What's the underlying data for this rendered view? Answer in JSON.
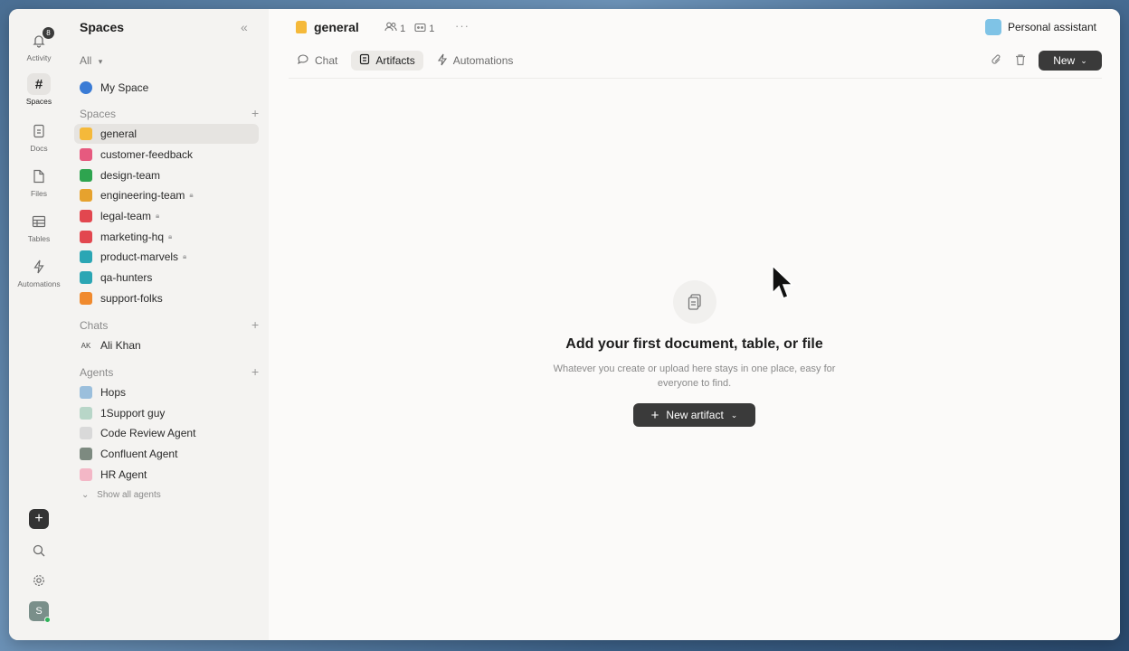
{
  "rail": {
    "activity_label": "Activity",
    "activity_badge": "8",
    "spaces_label": "Spaces",
    "docs_label": "Docs",
    "files_label": "Files",
    "tables_label": "Tables",
    "automations_label": "Automations",
    "user_initial": "S"
  },
  "sidebar": {
    "title": "Spaces",
    "filter": "All",
    "my_space": "My Space",
    "spaces_header": "Spaces",
    "spaces": [
      {
        "label": "general",
        "color": "#f5b93a"
      },
      {
        "label": "customer-feedback",
        "color": "#e65a7f"
      },
      {
        "label": "design-team",
        "color": "#2ea44f"
      },
      {
        "label": "engineering-team",
        "color": "#e6a22e"
      },
      {
        "label": "legal-team",
        "color": "#e2474f"
      },
      {
        "label": "marketing-hq",
        "color": "#e2474f"
      },
      {
        "label": "product-marvels",
        "color": "#2ba6b4"
      },
      {
        "label": "qa-hunters",
        "color": "#2ba6b4"
      },
      {
        "label": "support-folks",
        "color": "#f08a2e"
      }
    ],
    "chats_header": "Chats",
    "chats": [
      {
        "initials": "AK",
        "label": "Ali Khan"
      }
    ],
    "agents_header": "Agents",
    "agents": [
      {
        "label": "Hops"
      },
      {
        "label": "1Support guy"
      },
      {
        "label": "Code Review Agent"
      },
      {
        "label": "Confluent Agent"
      },
      {
        "label": "HR Agent"
      }
    ],
    "show_all": "Show all agents"
  },
  "header": {
    "space_name": "general",
    "members_count": "1",
    "agents_count": "1",
    "assistant": "Personal assistant"
  },
  "tabs": {
    "chat": "Chat",
    "artifacts": "Artifacts",
    "automations": "Automations"
  },
  "toolbar": {
    "new_label": "New"
  },
  "empty": {
    "title": "Add your first document, table, or file",
    "subtitle": "Whatever you create or upload here stays in one place, easy for everyone to find.",
    "button": "New artifact"
  }
}
